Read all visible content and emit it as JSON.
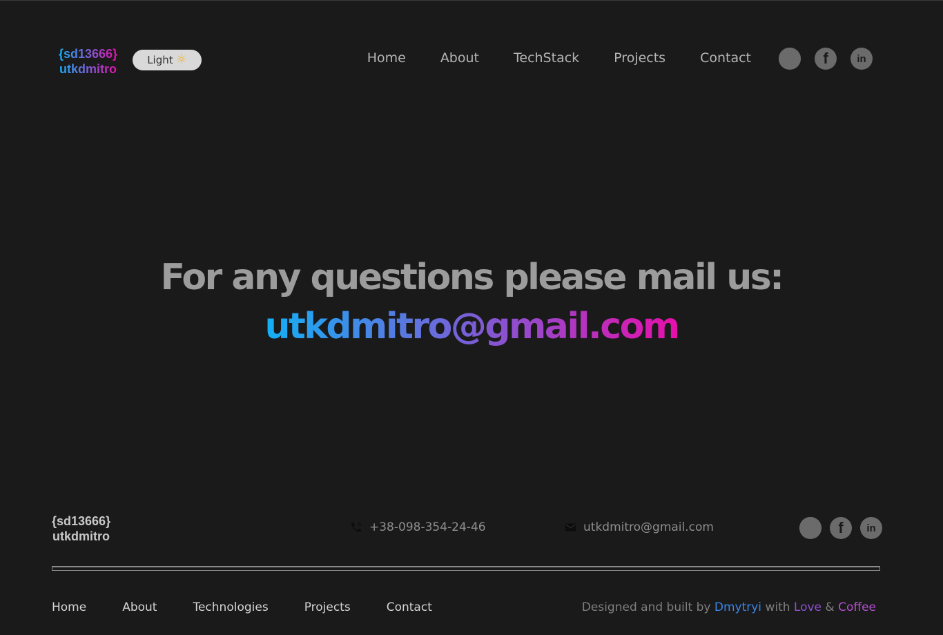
{
  "header": {
    "logo_line1": "{sd13666}",
    "logo_line2": "utkdmitro",
    "theme_label": "Light",
    "theme_icon": "sun-icon",
    "nav": [
      "Home",
      "About",
      "TechStack",
      "Projects",
      "Contact"
    ],
    "social_icons": [
      "github-icon",
      "facebook-icon",
      "linkedin-icon"
    ]
  },
  "hero": {
    "line1": "For any questions please mail us:",
    "email": "utkdmitro@gmail.com"
  },
  "footer": {
    "logo_line1": "{sd13666}",
    "logo_line2": "utkdmitro",
    "phone": "+38-098-354-24-46",
    "email": "utkdmitro@gmail.com",
    "nav": [
      "Home",
      "About",
      "Technologies",
      "Projects",
      "Contact"
    ],
    "credit": {
      "prefix": "Designed and built by",
      "name": "Dmytryi",
      "with": "with",
      "love": "Love",
      "amp": "&",
      "coffee": "Coffee"
    }
  },
  "colors": {
    "background": "#1a1a1b",
    "gradient_start": "#13b0f5",
    "gradient_end": "#e70faa",
    "nav_text": "#b5b5b5"
  }
}
